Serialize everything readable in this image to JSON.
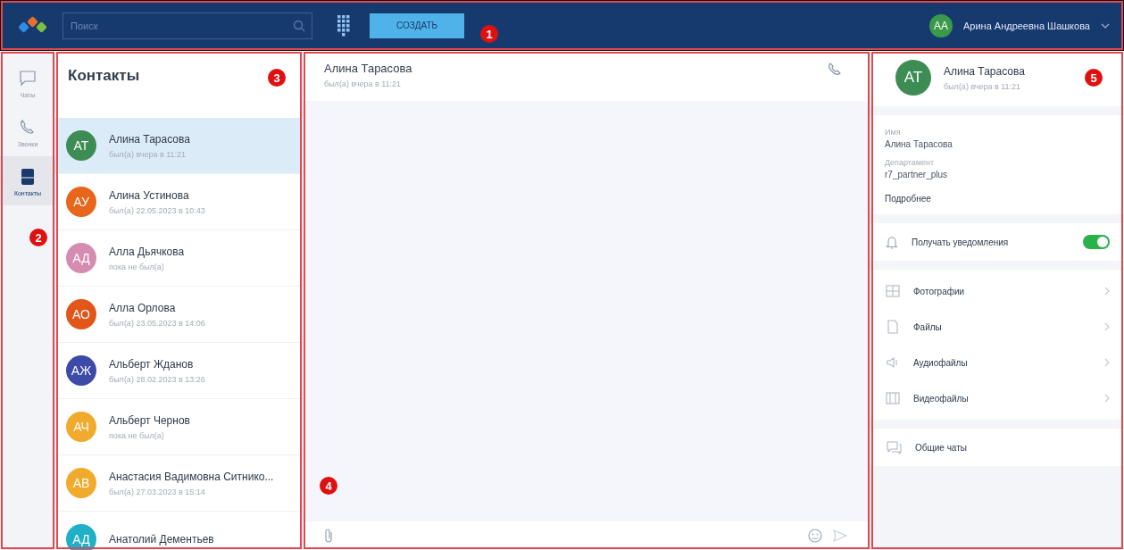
{
  "top_bar": {
    "search": {
      "placeholder": "Поиск"
    },
    "create_button": "СОЗДАТЬ",
    "user": {
      "initials": "АА",
      "name": "Арина Андреевна Шашкова",
      "color": "#3b9a4a"
    }
  },
  "nav": [
    {
      "label": "Чаты",
      "kind": "chat",
      "selected": false
    },
    {
      "label": "Звонки",
      "kind": "phone",
      "selected": false
    },
    {
      "label": "Контакты",
      "kind": "contacts",
      "selected": true
    }
  ],
  "contacts": {
    "title": "Контакты",
    "items": [
      {
        "initials": "АТ",
        "name": "Алина Тарасова",
        "status": "был(а) вчера в 11:21",
        "color": "#3d8c53",
        "selected": true
      },
      {
        "initials": "АУ",
        "name": "Алина Устинова",
        "status": "был(а) 22.05.2023 в 10:43",
        "color": "#e8661c",
        "selected": false
      },
      {
        "initials": "АД",
        "name": "Алла Дьячкова",
        "status": "пока не был(а)",
        "color": "#d68bb0",
        "selected": false
      },
      {
        "initials": "АО",
        "name": "Алла Орлова",
        "status": "был(а) 23.05.2023 в 14:06",
        "color": "#e2561a",
        "selected": false
      },
      {
        "initials": "АЖ",
        "name": "Альберт Жданов",
        "status": "был(а) 28.02.2023 в 13:26",
        "color": "#3d4aa8",
        "selected": false
      },
      {
        "initials": "АЧ",
        "name": "Альберт Чернов",
        "status": "пока не был(а)",
        "color": "#f0aa2c",
        "selected": false
      },
      {
        "initials": "АВ",
        "name": "Анастасия Вадимовна Ситнико...",
        "status": "был(а) 27.03.2023 в 15:14",
        "color": "#f0aa2c",
        "selected": false
      },
      {
        "initials": "АД",
        "name": "Анатолий Дементьев",
        "color": "#1fb0c8",
        "selected": false
      }
    ]
  },
  "chat": {
    "name": "Алина Тарасова",
    "status": "был(а) вчера в 11:21"
  },
  "profile": {
    "initials": "АТ",
    "color": "#3d8c53",
    "name": "Алина Тарасова",
    "status": "был(а) вчера в 11:21",
    "fields": [
      {
        "label": "Имя",
        "value": "Алина Тарасова"
      },
      {
        "label": "Департамент",
        "value": "r7_partner_plus"
      }
    ],
    "more_link": "Подробнее",
    "notifications": {
      "label": "Получать уведомления",
      "on": true
    },
    "media": [
      {
        "label": "Фотографии",
        "kind": "photo"
      },
      {
        "label": "Файлы",
        "kind": "file"
      },
      {
        "label": "Аудиофайлы",
        "kind": "audio"
      },
      {
        "label": "Видеофайлы",
        "kind": "video"
      }
    ],
    "shared_chats": "Общие чаты"
  },
  "annotations": [
    "1",
    "2",
    "3",
    "4",
    "5"
  ]
}
